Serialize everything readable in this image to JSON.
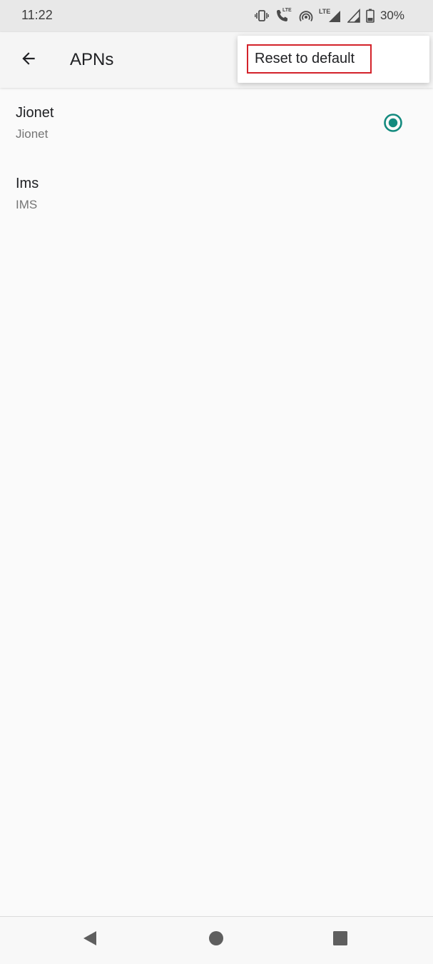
{
  "status_bar": {
    "time": "11:22",
    "battery_percent": "30%",
    "icons": [
      "vibrate-icon",
      "volte-call-icon",
      "hotspot-icon",
      "lte-signal-icon",
      "signal-icon",
      "battery-icon"
    ],
    "volte_label": "LTE",
    "lte_label": "LTE"
  },
  "app_bar": {
    "title": "APNs",
    "back_icon": "arrow-back-icon"
  },
  "overflow_menu": {
    "items": [
      {
        "label": "Reset to default",
        "highlight_color": "#d3222a"
      }
    ]
  },
  "apn_list": [
    {
      "name": "Jionet",
      "subtitle": "Jionet",
      "selected": true
    },
    {
      "name": "Ims",
      "subtitle": "IMS",
      "selected": false
    }
  ],
  "colors": {
    "accent": "#138a7e",
    "status_bar_bg": "#e8e8e8",
    "app_bar_bg": "#f5f5f5",
    "background": "#fafafa"
  },
  "nav_bar": {
    "icons": [
      "nav-back-icon",
      "nav-home-icon",
      "nav-recents-icon"
    ]
  }
}
